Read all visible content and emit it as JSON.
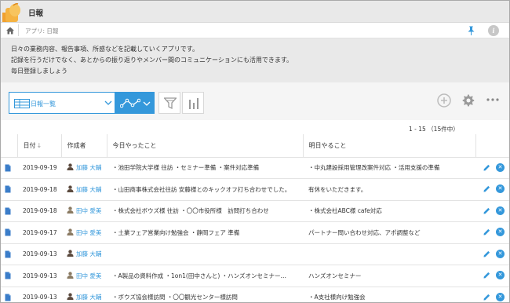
{
  "app": {
    "title": "日報",
    "breadcrumb": "アプリ: 日報",
    "info_glyph": "i"
  },
  "description": {
    "lines": [
      "日々の業務内容、報告事項、所感などを記載していくアプリです。",
      "記録を行うだけでなく、あとからの振り返りやメンバー間のコミュニケーションにも活用できます。",
      "毎日登録しましょう"
    ]
  },
  "toolbar": {
    "view_label": "日報一覧"
  },
  "record_count": "1 - 15 （15件中）",
  "table": {
    "headers": {
      "date": "日付",
      "date_sort": "↓",
      "author": "作成者",
      "today": "今日やったこと",
      "tomorrow": "明日やること"
    },
    "rows": [
      {
        "date": "2019-09-19",
        "author": "加藤 大輔",
        "author_color": "#5b4a3e",
        "today": "・池田学院大学様 往訪 ・セミナー準備 ・案件対応準備",
        "tomorrow": "・中丸建設採用管理改案件対応 ・活用支援の準備"
      },
      {
        "date": "2019-09-18",
        "author": "加藤 大輔",
        "author_color": "#5b4a3e",
        "today": "・山田商事株式会社往訪 安藤様とのキックオフ打ち合わせでした。",
        "tomorrow": "有休をいただきます。"
      },
      {
        "date": "2019-09-18",
        "author": "田中 愛美",
        "author_color": "#8a7a62",
        "today": "・株式会社ボウズ様 往訪 ・〇〇市役所様　訪問打ち合わせ",
        "tomorrow": "・株式会社ABC様 cafe対応"
      },
      {
        "date": "2019-09-17",
        "author": "田中 愛美",
        "author_color": "#8a7a62",
        "today": "・土業フェア営業向け勉強会 ・静岡フェア 準備",
        "tomorrow": "パートナー問い合わせ対応、アポ調整など"
      },
      {
        "date": "2019-09-13",
        "author": "加藤 大輔",
        "author_color": "#5b4a3e",
        "today": "",
        "tomorrow": ""
      },
      {
        "date": "2019-09-13",
        "author": "田中 愛美",
        "author_color": "#8a7a62",
        "today": "・A製品の資料作成 ・1on1(田中さんと) ・ハンズオンセミナー…",
        "tomorrow": "ハンズオンセミナー"
      },
      {
        "date": "2019-09-13",
        "author": "加藤 大輔",
        "author_color": "#5b4a3e",
        "today": "・ボウズ協会様訪問 ・〇〇観光センター様訪問",
        "tomorrow": "・A支社様向け勉強会"
      }
    ]
  },
  "colors": {
    "accent": "#3498db",
    "header_bg": "#e9e9e9",
    "toolbar_bg": "#f5f5f5",
    "icon_orange": "#f0a030"
  },
  "icons": {
    "app": "app-orange-icon",
    "home": "home-icon",
    "pin": "pin-icon",
    "info": "info-icon",
    "view": "grid-icon",
    "graph": "line-chart-icon",
    "filter": "filter-icon",
    "bars": "bar-chart-icon",
    "add": "plus-icon",
    "settings": "gear-icon",
    "more": "more-icon",
    "record": "document-icon",
    "edit": "pencil-icon",
    "delete": "close-icon"
  }
}
